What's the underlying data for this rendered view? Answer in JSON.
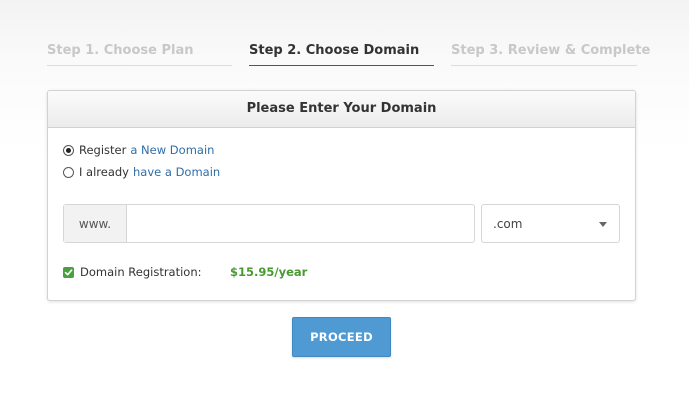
{
  "steps": [
    {
      "label": "Step 1. Choose Plan",
      "state": "done"
    },
    {
      "label": "Step 2. Choose Domain",
      "state": "active"
    },
    {
      "label": "Step 3. Review & Complete",
      "state": "pending"
    }
  ],
  "card": {
    "title": "Please Enter Your Domain",
    "options": [
      {
        "prefix": "Register",
        "link": "a New Domain",
        "selected": true
      },
      {
        "prefix": "I already",
        "link": "have a Domain",
        "selected": false
      }
    ],
    "domain": {
      "prefix": "www.",
      "value": "",
      "placeholder": ""
    },
    "tld": {
      "selected": ".com"
    },
    "registration": {
      "label": "Domain Registration:",
      "checked": true,
      "price": "$15.95/year"
    }
  },
  "proceed_label": "PROCEED",
  "colors": {
    "accent_blue": "#4f9ad3",
    "link": "#2f6ea8",
    "price_green": "#4a9a34",
    "checkbox_green": "#4aa03f"
  }
}
